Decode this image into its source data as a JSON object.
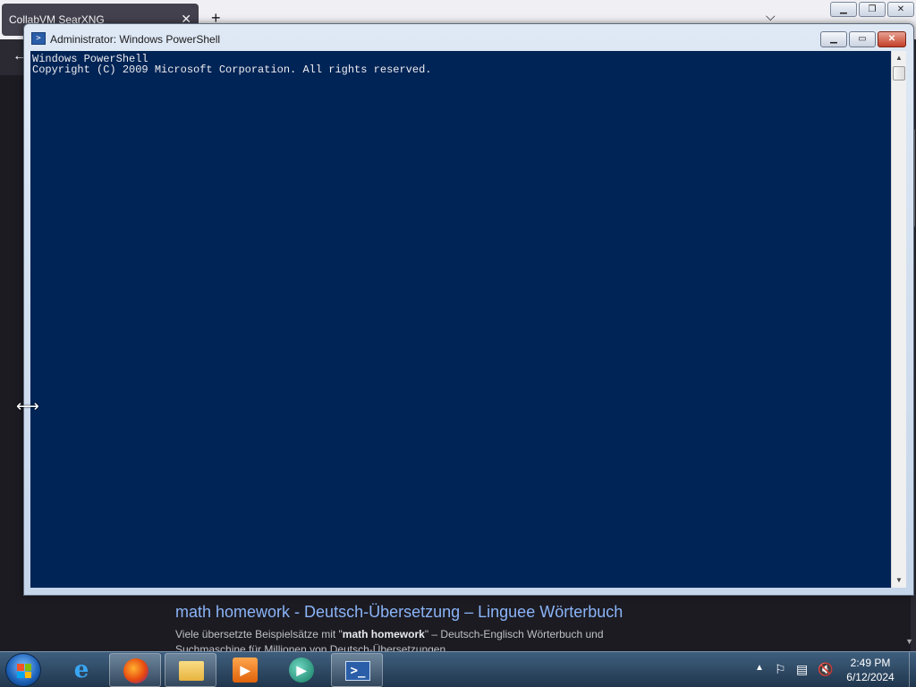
{
  "browser": {
    "tab_title": "CollabVM SearXNG",
    "tab_close": "✕",
    "new_tab": "+",
    "tab_list": "⌵",
    "back": "←",
    "win_buttons": [
      "▁",
      "❐",
      "✕"
    ],
    "result": {
      "title": "math homework - Deutsch-Übersetzung – Linguee Wörterbuch",
      "snippet_pre": "Viele übersetzte Beispielsätze mit \"",
      "snippet_bold": "math homework",
      "snippet_post": "\" – Deutsch-Englisch Wörterbuch und Suchmaschine für Millionen von Deutsch-Übersetzungen."
    }
  },
  "powershell": {
    "title": "Administrator: Windows PowerShell",
    "console_lines": [
      "Windows PowerShell",
      "Copyright (C) 2009 Microsoft Corporation. All rights reserved."
    ],
    "controls": [
      "▁",
      "▭",
      "✕"
    ],
    "bg_color": "#012456",
    "fg_color": "#eeedf0"
  },
  "taskbar": {
    "items": [
      {
        "name": "internet-explorer",
        "glyph": "e"
      },
      {
        "name": "firefox",
        "glyph": ""
      },
      {
        "name": "windows-explorer",
        "glyph": ""
      },
      {
        "name": "media-player",
        "glyph": "▶"
      },
      {
        "name": "collabvm",
        "glyph": "▶"
      },
      {
        "name": "powershell",
        "glyph": ">_"
      }
    ],
    "tray": {
      "chevron": "▲",
      "flag": "⚐",
      "network": "▤",
      "volume": "🔇"
    },
    "clock": {
      "time": "2:49 PM",
      "date": "6/12/2024"
    }
  }
}
